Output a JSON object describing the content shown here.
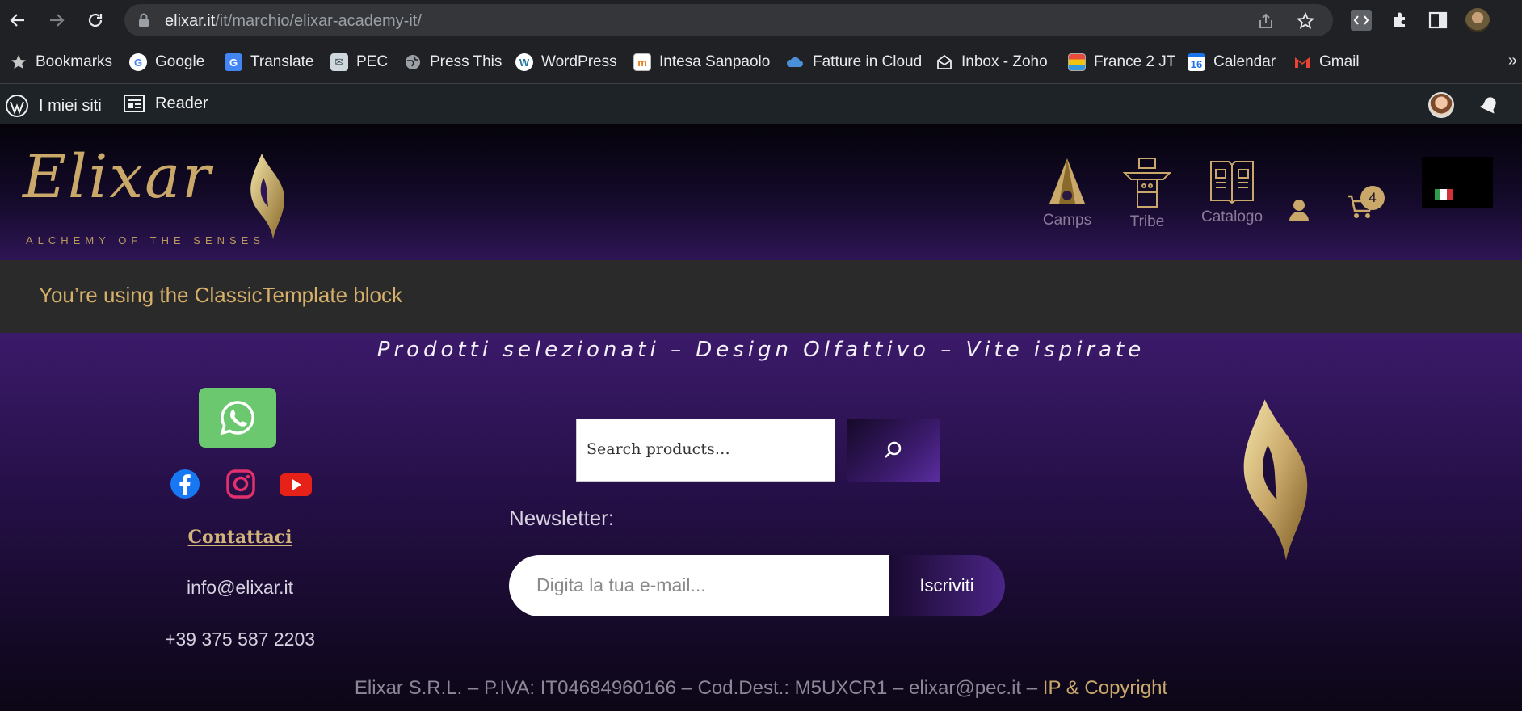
{
  "browser": {
    "url_domain": "elixar.it",
    "url_path": "/it/marchio/elixar-academy-it/",
    "bookmarks": [
      {
        "label": "Bookmarks",
        "icon": "star-icon"
      },
      {
        "label": "Google",
        "icon": "google-icon"
      },
      {
        "label": "Translate",
        "icon": "translate-icon"
      },
      {
        "label": "PEC",
        "icon": "pec-icon"
      },
      {
        "label": "Press This",
        "icon": "globe-icon"
      },
      {
        "label": "WordPress",
        "icon": "wordpress-icon"
      },
      {
        "label": "Intesa Sanpaolo",
        "icon": "bank-icon"
      },
      {
        "label": "Fatture in Cloud",
        "icon": "cloud-icon"
      },
      {
        "label": "Inbox - Zoho",
        "icon": "mail-icon"
      },
      {
        "label": "France 2 JT",
        "icon": "tv-icon"
      },
      {
        "label": "Calendar",
        "icon": "calendar-icon"
      },
      {
        "label": "Gmail",
        "icon": "gmail-icon"
      }
    ],
    "calendar_day": "16",
    "more": "»"
  },
  "adminbar": {
    "my_sites": "I miei siti",
    "reader": "Reader"
  },
  "header": {
    "logo": "Elixar",
    "logo_sub": "ALCHEMY OF THE SENSES",
    "nav": {
      "camps": "Camps",
      "tribe": "Tribe",
      "catalogo": "Catalogo"
    },
    "cart_count": "4"
  },
  "notice": "You’re using the ClassicTemplate block",
  "footer": {
    "tagline": "Prodotti selezionati – Design Olfattivo – Vite ispirate",
    "contact_link": "Contattaci",
    "email": "info@elixar.it",
    "phone": "+39 375 587 2203",
    "search_placeholder": "Search products…",
    "newsletter_label": "Newsletter:",
    "newsletter_placeholder": "Digita la tua e-mail...",
    "subscribe": "Iscriviti",
    "copyright_text": "Elixar S.R.L. – P.IVA: IT04684960166 – Cod.Dest.: M5UXCR1 – elixar@pec.it – ",
    "copyright_link": "IP & Copyright"
  },
  "colors": {
    "gold": "#c9a86a",
    "purple": "#3b1a6a",
    "whatsapp": "#6cc86e"
  }
}
